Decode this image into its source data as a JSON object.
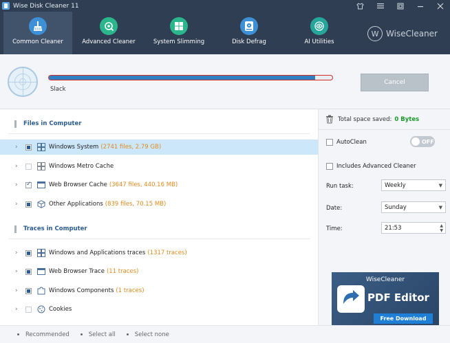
{
  "window": {
    "title": "Wise Disk Cleaner 11",
    "controls": [
      "shirt-icon",
      "menu-icon",
      "restore-icon",
      "minimize-icon",
      "close-icon"
    ]
  },
  "toolbar": {
    "items": [
      {
        "label": "Common Cleaner",
        "icon": "broom-icon",
        "active": true
      },
      {
        "label": "Advanced Cleaner",
        "icon": "gear-scan-icon",
        "active": false
      },
      {
        "label": "System Slimming",
        "icon": "windows-icon",
        "active": false
      },
      {
        "label": "Disk Defrag",
        "icon": "disk-icon",
        "active": false
      },
      {
        "label": "AI Utilities",
        "icon": "ai-icon",
        "active": false
      }
    ],
    "brand": "WiseCleaner"
  },
  "scan": {
    "progress_percent": 94,
    "current_item": "Slack",
    "cancel_label": "Cancel"
  },
  "files_section": {
    "title": "Files in Computer",
    "items": [
      {
        "label": "Windows System",
        "detail": "(2741 files, 2.79 GB)",
        "check": "partial",
        "selected": true
      },
      {
        "label": "Windows Metro Cache",
        "detail": "",
        "check": "empty",
        "selected": false
      },
      {
        "label": "Web Browser Cache",
        "detail": "(3647 files, 440.16 MB)",
        "check": "checked",
        "selected": false
      },
      {
        "label": "Other Applications",
        "detail": "(839 files, 70.15 MB)",
        "check": "partial",
        "selected": false
      }
    ]
  },
  "traces_section": {
    "title": "Traces in Computer",
    "items": [
      {
        "label": "Windows and Applications traces",
        "detail": "(1317 traces)",
        "check": "partial"
      },
      {
        "label": "Web Browser Trace",
        "detail": "(11 traces)",
        "check": "partial"
      },
      {
        "label": "Windows Components",
        "detail": "(1 traces)",
        "check": "partial"
      },
      {
        "label": "Cookies",
        "detail": "",
        "check": "empty"
      }
    ]
  },
  "footer": {
    "recommended": "Recommended",
    "select_all": "Select all",
    "select_none": "Select none"
  },
  "right_panel": {
    "space_label": "Total space saved:",
    "space_value": "0 Bytes",
    "autoclean_label": "AutoClean",
    "autoclean_toggle": "OFF",
    "include_advanced_label": "Includes Advanced Cleaner",
    "run_task_label": "Run task:",
    "run_task_value": "Weekly",
    "date_label": "Date:",
    "date_value": "Sunday",
    "time_label": "Time:",
    "time_value": "21:53"
  },
  "ad": {
    "brand": "WiseCleaner",
    "product": "PDF Editor",
    "button": "Free Download"
  },
  "colors": {
    "header_bg": "#2f3e52",
    "accent_blue": "#2a5b94",
    "orange_detail": "#e08a1e",
    "green_value": "#1b9a2b",
    "progress_fill": "#2f7fc1",
    "progress_border": "#d62a2a"
  }
}
